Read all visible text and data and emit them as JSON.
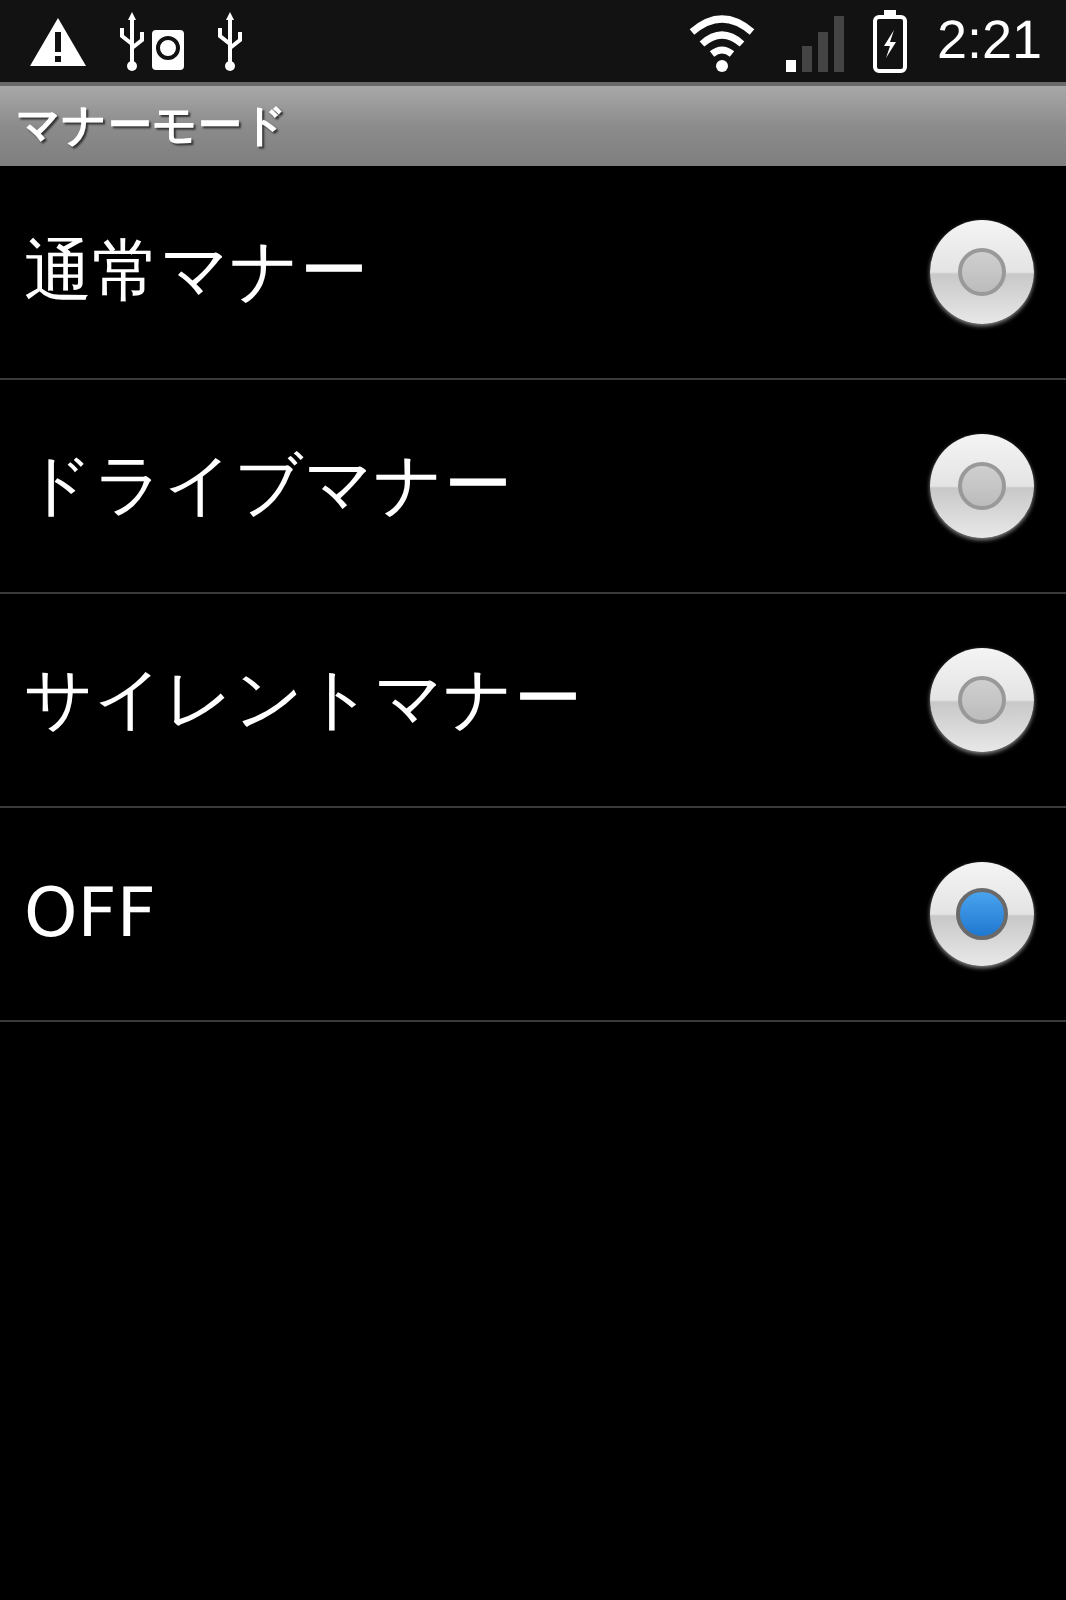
{
  "status_bar": {
    "time": "2:21"
  },
  "title": "マナーモード",
  "options": [
    {
      "label": "通常マナー",
      "selected": false
    },
    {
      "label": "ドライブマナー",
      "selected": false
    },
    {
      "label": "サイレントマナー",
      "selected": false
    },
    {
      "label": "OFF",
      "selected": true
    }
  ]
}
